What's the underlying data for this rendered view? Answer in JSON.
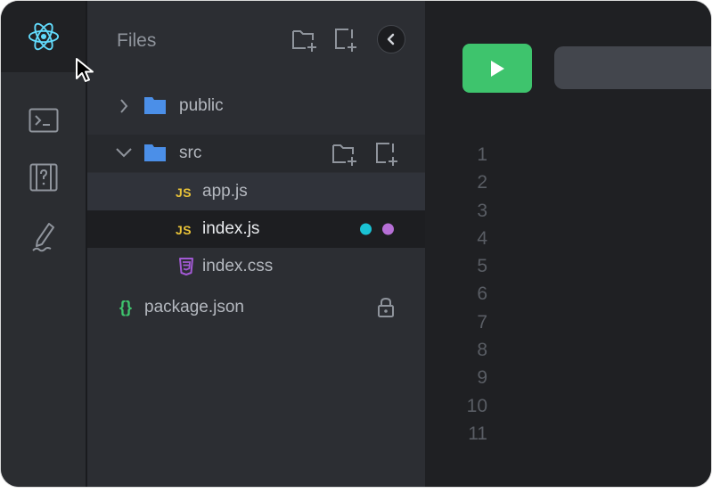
{
  "explorer": {
    "title": "Files"
  },
  "tree": {
    "public": "public",
    "src": "src",
    "app": "app.js",
    "index": "index.js",
    "css": "index.css",
    "package": "package.json",
    "js_badge": "JS",
    "json_badge": "{}"
  },
  "status_colors": {
    "dot1": "#1ac2d4",
    "dot2": "#b66fd6"
  },
  "editor": {
    "line_numbers": [
      "1",
      "2",
      "3",
      "4",
      "5",
      "6",
      "7",
      "8",
      "9",
      "10",
      "11"
    ]
  },
  "icons": {
    "activity": [
      "react-icon",
      "terminal-icon",
      "help-icon",
      "pen-icon"
    ]
  },
  "colors": {
    "run_button": "#3ec46d",
    "react": "#61dafb",
    "folder": "#4b8fe8",
    "css_icon": "#a259d4",
    "json_icon": "#3ec46d"
  }
}
